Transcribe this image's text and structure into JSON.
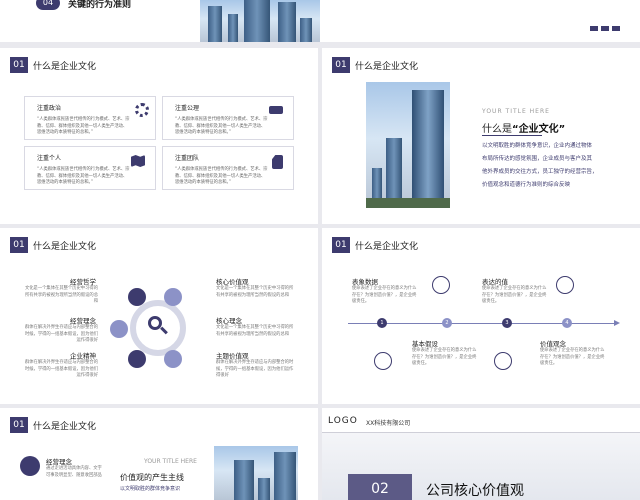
{
  "top_banner": {
    "number": "04",
    "title": "关键的行为准则"
  },
  "section_title": "什么是企业文化",
  "section_number": "01",
  "s1": {
    "cards": [
      {
        "title": "注重政治",
        "text": "“人类群体或民族世代相传的行为模式、艺术、宗教、信仰、群体组织及其他一切人类生产活动、思维活动的本质特征的总和。”"
      },
      {
        "title": "注重公理",
        "text": "“人类群体或民族世代相传的行为模式、艺术、宗教、信仰、群体组织及其他一切人类生产活动、思维活动的本质特征的总和。”"
      },
      {
        "title": "注重个人",
        "text": "“人类群体或民族世代相传的行为模式、艺术、宗教、信仰、群体组织及其他一切人类生产活动、思维活动的本质特征的总和。”"
      },
      {
        "title": "注重团队",
        "text": "“人类群体或民族世代相传的行为模式、艺术、宗教、信仰、群体组织及其他一切人类生产活动、思维活动的本质特征的总和。”"
      }
    ]
  },
  "s2": {
    "your_title": "YOUR TITLE HERE",
    "heading_prefix": "什么是",
    "heading_highlight": "“企业文化”",
    "lines": [
      "以文明取胜的群体竞争意识，企业内通过物体",
      "布局所传达的感觉氛围，企业成员与客户及其",
      "他外界成员的交往方式，员工独守的经营宗旨，",
      "价值观念和道德行为准则的综合反映"
    ]
  },
  "s3": {
    "left": [
      {
        "title": "经营哲学",
        "text": "文化是一个集体在其整个历史中习得的所有共享的被视为理所当然的假设的总和"
      },
      {
        "title": "经营理念",
        "text": "群体在解决外界生存适应与内部整合的时候，学得的一组基本假设，因为他们运作得很好"
      },
      {
        "title": "企业精神",
        "text": "群体在解决外界生存适应与内部整合的时候，学得的一组基本假设，因为他们运作得很好"
      }
    ],
    "right": [
      {
        "title": "核心价值观",
        "text": "文化是一个集体在其整个历史中习得的所有共享的被视为理所当然的假设的总和"
      },
      {
        "title": "核心理念",
        "text": "文化是一个集体在其整个历史中习得的所有共享的被视为理所当然的假设的总和"
      },
      {
        "title": "主题价值观",
        "text": "群体在解决外界生存适应与内部整合的时候，学得的一组基本假设，因为他们运作得很好"
      }
    ]
  },
  "s4": {
    "top": [
      {
        "title": "表象数据",
        "text": "使命表述了企业存在的意义为什么存在？为谁创造价值？，是企业终极责任。"
      },
      {
        "title": "表达的值",
        "text": "使命表述了企业存在的意义为什么存在？为谁创造价值？，是企业终极责任。"
      }
    ],
    "bottom": [
      {
        "title": "基本假设",
        "text": "使命表述了企业存在的意义为什么存在？为谁创造价值？，是企业终极责任。"
      },
      {
        "title": "价值观念",
        "text": "使命表述了企业存在的意义为什么存在？为谁创造价值？，是企业终极责任。"
      }
    ],
    "steps": [
      "1",
      "2",
      "3",
      "4"
    ]
  },
  "s5": {
    "item_title": "经营理念",
    "item_text": "通过走进活动具体内容、文字可事及明显型、随意收回部品",
    "your_title": "YOUR TITLE HERE",
    "subheading": "价值观的产生主线",
    "subtext": "以文明取胜的群体竞争意识"
  },
  "s6": {
    "logo": "LOGO",
    "company": "XX科技有限公司",
    "number": "02",
    "title": "公司核心价值观"
  },
  "colors": {
    "accent": "#3d3b6e",
    "line": "#7a7fb6",
    "node": "#8c92c7"
  }
}
